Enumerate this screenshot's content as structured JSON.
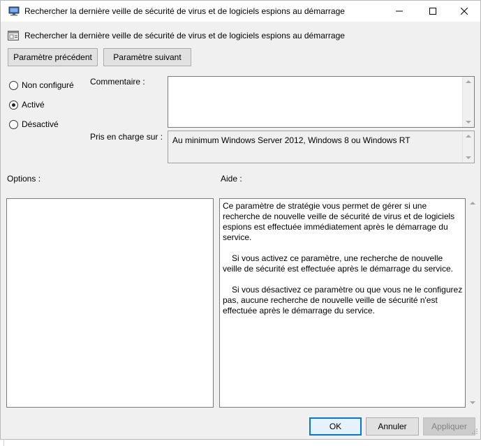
{
  "window": {
    "title": "Rechercher la dernière veille de sécurité de virus et de logiciels espions au démarrage"
  },
  "header": {
    "title": "Rechercher la dernière veille de sécurité de virus et de logiciels espions au démarrage"
  },
  "nav": {
    "prev_label": "Paramètre précédent",
    "next_label": "Paramètre suivant"
  },
  "state": {
    "options": [
      {
        "label": "Non configuré",
        "checked": false
      },
      {
        "label": "Activé",
        "checked": true
      },
      {
        "label": "Désactivé",
        "checked": false
      }
    ]
  },
  "comment": {
    "label": "Commentaire :",
    "value": ""
  },
  "supported": {
    "label": "Pris en charge sur :",
    "value": "Au minimum Windows Server 2012, Windows 8 ou Windows RT"
  },
  "options_pane": {
    "label": "Options :"
  },
  "help_pane": {
    "label": "Aide :",
    "paragraphs": [
      "Ce paramètre de stratégie vous permet de gérer si une recherche de nouvelle veille de sécurité de virus et de logiciels espions est effectuée immédiatement après le démarrage du service.",
      "Si vous activez ce paramètre, une recherche de nouvelle veille de sécurité est effectuée après le démarrage du service.",
      "Si vous désactivez ce paramètre ou que vous ne le configurez pas, aucune recherche de nouvelle veille de sécurité n'est effectuée après le démarrage du service."
    ]
  },
  "footer": {
    "ok_label": "OK",
    "cancel_label": "Annuler",
    "apply_label": "Appliquer"
  }
}
